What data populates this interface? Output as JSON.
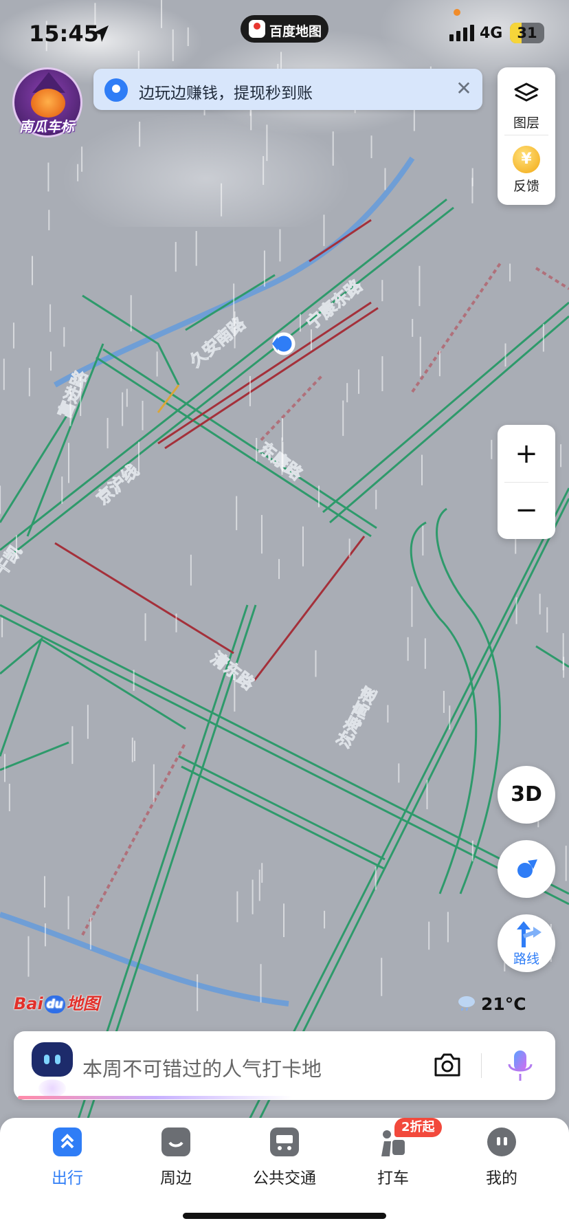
{
  "status_bar": {
    "time": "15:45",
    "network": "4G",
    "battery": "31",
    "app_pill": "百度地图"
  },
  "avatar": {
    "label": "南瓜车标"
  },
  "banner": {
    "text": "边玩边赚钱，提现秒到账",
    "icon": "location-pin-icon",
    "close_icon": "close-icon"
  },
  "right_panel": {
    "layers_label": "图层",
    "feedback_label": "反馈",
    "feedback_coin": "¥",
    "zoom_in": "+",
    "zoom_out": "−",
    "btn_3d": "3D",
    "route_label": "路线"
  },
  "map": {
    "road_labels": [
      "宁康东路",
      "久安南路",
      "富进路",
      "京沪线",
      "东康路",
      "清东路",
      "沈海高速",
      "干凯"
    ],
    "colors": {
      "road": "#2e9a6b",
      "congested": "#a4303a",
      "slow": "#d9a63a",
      "river": "#6f9ed6",
      "background": "#a9adb5"
    }
  },
  "map_footer": {
    "logo_a": "Bai",
    "logo_du": "du",
    "logo_b": "地图",
    "temperature": "21°C"
  },
  "search": {
    "placeholder": "本周不可错过的人气打卡地"
  },
  "tabs": [
    {
      "label": "出行",
      "icon": "travel-icon",
      "active": true
    },
    {
      "label": "周边",
      "icon": "nearby-icon"
    },
    {
      "label": "公共交通",
      "icon": "bus-icon"
    },
    {
      "label": "打车",
      "icon": "taxi-icon",
      "badge": "2折起"
    },
    {
      "label": "我的",
      "icon": "profile-icon"
    }
  ],
  "accent": "#2f7df6"
}
